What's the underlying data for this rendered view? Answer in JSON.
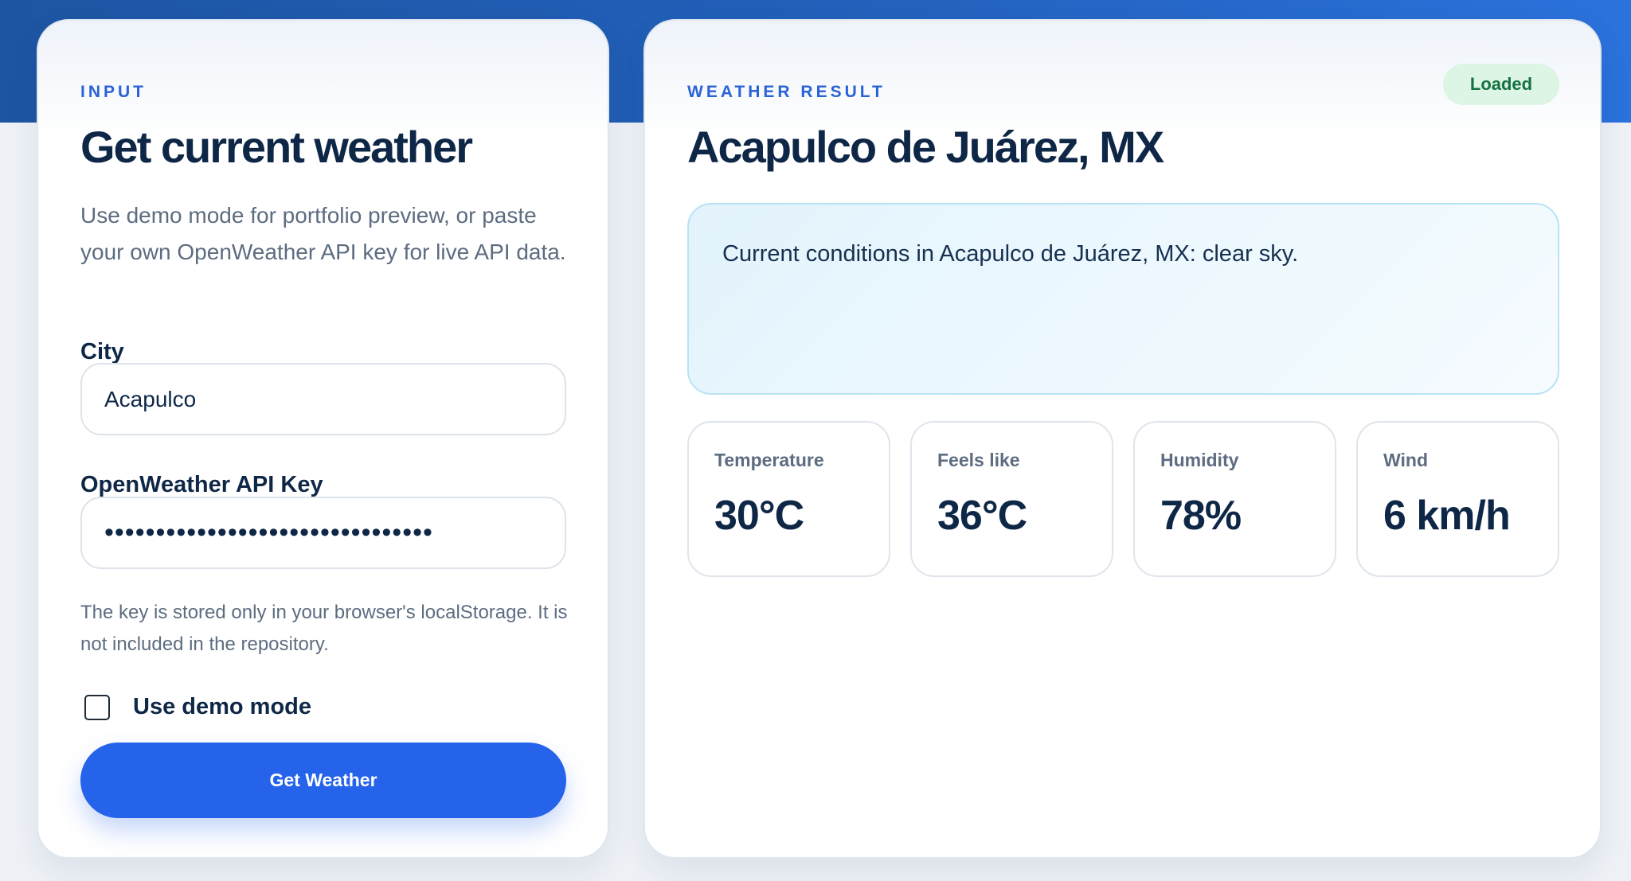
{
  "input_card": {
    "eyebrow": "INPUT",
    "title": "Get current weather",
    "description": "Use demo mode for portfolio preview, or paste your own OpenWeather API key for live API data.",
    "city_label": "City",
    "city_value": "Acapulco",
    "api_key_label": "OpenWeather API Key",
    "api_key_value": "••••••••••••••••••••••••••••••••",
    "helper_text": "The key is stored only in your browser's localStorage. It is not included in the repository.",
    "demo_mode_label": "Use demo mode",
    "demo_mode_checked": false,
    "submit_label": "Get Weather"
  },
  "result_card": {
    "eyebrow": "WEATHER RESULT",
    "status": "Loaded",
    "location": "Acapulco de Juárez, MX",
    "summary": "Current conditions in Acapulco de Juárez, MX: clear sky.",
    "metrics": [
      {
        "label": "Temperature",
        "value": "30°C"
      },
      {
        "label": "Feels like",
        "value": "36°C"
      },
      {
        "label": "Humidity",
        "value": "78%"
      },
      {
        "label": "Wind",
        "value": "6 km/h"
      }
    ]
  },
  "colors": {
    "accent": "#2563eb",
    "header_band": "#1d55a2",
    "status_bg": "#dcf5e4",
    "status_text": "#157142",
    "panel_bg": "#e3f3fc"
  }
}
